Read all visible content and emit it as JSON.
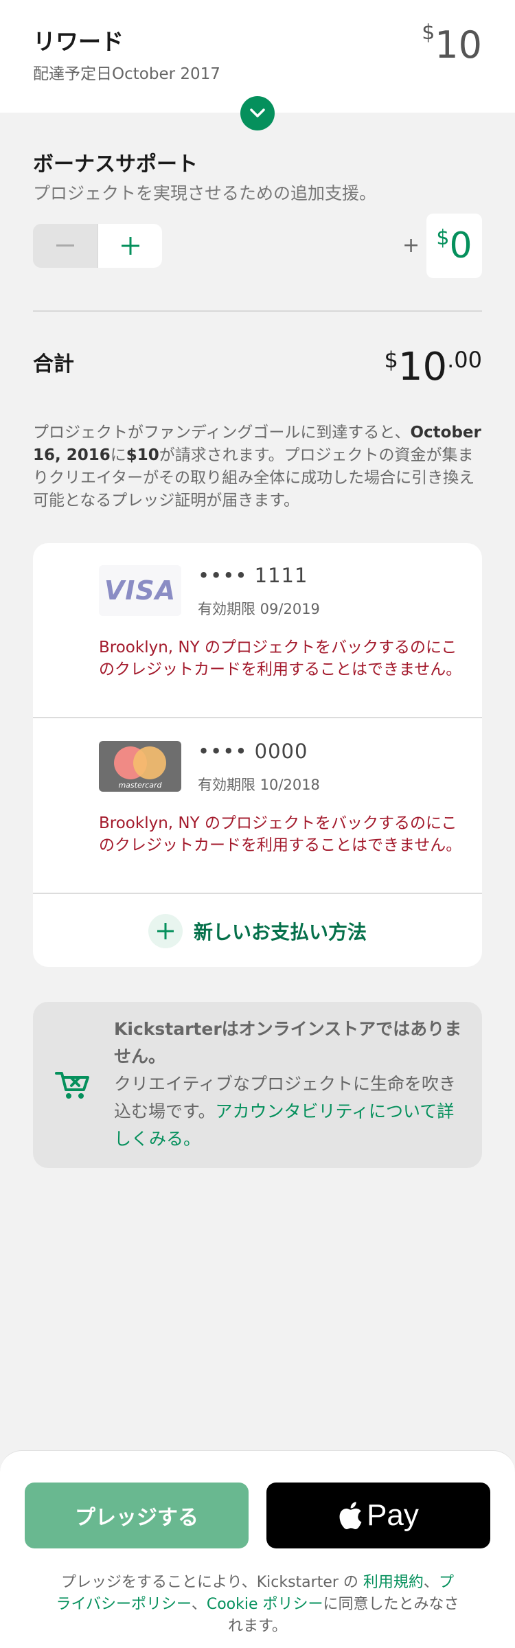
{
  "reward": {
    "title": "リワード",
    "delivery": "配達予定日October 2017",
    "currency": "$",
    "amount": "10"
  },
  "bonus": {
    "title": "ボーナスサポート",
    "subtitle": "プロジェクトを実現させるための追加支援。",
    "plus_sign": "+",
    "currency": "$",
    "amount": "0"
  },
  "total": {
    "label": "合計",
    "currency": "$",
    "whole": "10",
    "cents": ".00"
  },
  "notice": {
    "part1": "プロジェクトがファンディングゴールに到達すると、",
    "date": "October 16, 2016",
    "part2": "に",
    "amount": "$10",
    "part3": "が請求されます。プロジェクトの資金が集まりクリエイターがその取り組み全体に成功した場合に引き換え可能となるプレッジ証明が届きます。"
  },
  "payment_methods": [
    {
      "brand": "VISA",
      "number": "•••• 1111",
      "expiry": "有効期限 09/2019",
      "error": "Brooklyn, NY のプロジェクトをバックするのにこのクレジットカードを利用することはできません。"
    },
    {
      "brand": "mastercard",
      "number": "•••• 0000",
      "expiry": "有効期限 10/2018",
      "error": "Brooklyn, NY のプロジェクトをバックするのにこのクレジットカードを利用することはできません。"
    }
  ],
  "new_payment_label": "新しいお支払い方法",
  "info": {
    "bold": "Kickstarterはオンラインストアではありません。",
    "text": "クリエイティブなプロジェクトに生命を吹き込む場です。",
    "link": "アカウンタビリティについて詳しくみる。"
  },
  "buttons": {
    "pledge": "プレッジする",
    "apple_pay": "Pay"
  },
  "terms": {
    "part1": "プレッジをすることにより、Kickstarter の ",
    "link1": "利用規約",
    "sep1": "、",
    "link2": "プライバシーポリシー",
    "sep2": "、",
    "link3": "Cookie ポリシー",
    "part2": "に同意したとみなされます。"
  },
  "colors": {
    "accent": "#05905c",
    "error": "#a3192b",
    "pledge_button": "#69b890"
  }
}
